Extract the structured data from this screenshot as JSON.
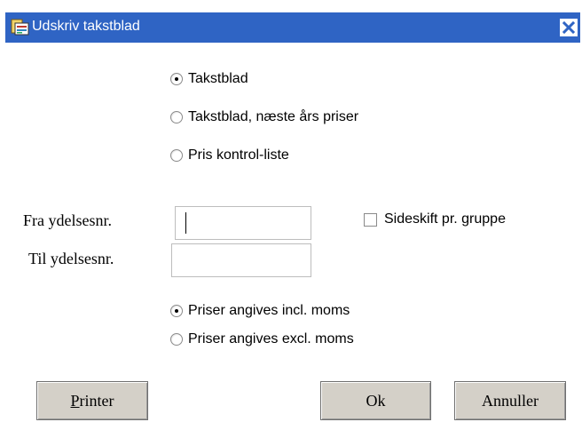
{
  "window": {
    "title": "Udskriv takstblad",
    "title_bar_color": "#2f64c4"
  },
  "report_type": {
    "options": [
      {
        "label": "Takstblad",
        "checked": true
      },
      {
        "label": "Takstblad, næste års priser",
        "checked": false
      },
      {
        "label": "Pris kontrol-liste",
        "checked": false
      }
    ]
  },
  "range": {
    "from_label": "Fra ydelsesnr.",
    "from_value": "",
    "to_label": "Til ydelsesnr.",
    "to_value": ""
  },
  "page_break": {
    "label": "Sideskift pr. gruppe",
    "checked": false
  },
  "vat": {
    "options": [
      {
        "label": "Priser angives incl. moms",
        "checked": true
      },
      {
        "label": "Priser angives excl. moms",
        "checked": false
      }
    ]
  },
  "buttons": {
    "printer_mnemonic": "P",
    "printer_rest": "rinter",
    "ok": "Ok",
    "cancel": "Annuller"
  }
}
